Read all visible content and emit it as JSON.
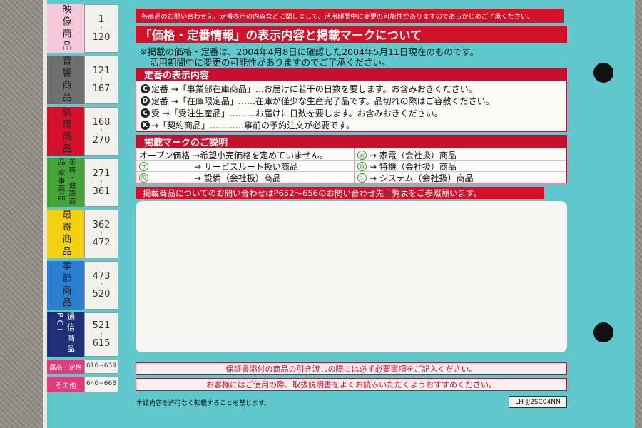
{
  "index": [
    {
      "label": "映像商品",
      "range_from": "1",
      "range_to": "120",
      "color": "#f5c7da"
    },
    {
      "label": "音響商品",
      "range_from": "121",
      "range_to": "167",
      "color": "#6f6f6f"
    },
    {
      "label": "調理商品",
      "range_from": "168",
      "range_to": "270",
      "color": "#d3122a"
    },
    {
      "label": "美容・健康商品 家事商品",
      "range_from": "271",
      "range_to": "361",
      "color": "#45a536"
    },
    {
      "label": "最寄商品",
      "range_from": "362",
      "range_to": "472",
      "color": "#f2d20e"
    },
    {
      "label": "季節商品",
      "range_from": "473",
      "range_to": "520",
      "color": "#2a7fd0"
    },
    {
      "label": "通信商品 PCI",
      "range_from": "521",
      "range_to": "615",
      "color": "#1e2f78"
    },
    {
      "label": "属品・定格",
      "range_text": "616~639",
      "color": "#e33a7a"
    },
    {
      "label": "その他",
      "range_text": "640~668",
      "color": "#e33a7a"
    }
  ],
  "notice": "各商品のお問い合わせ先、定番表示の内容などに関しまして、活用期間中に変更の可能性がありますのであらかじめご了承ください。",
  "title": "「価格・定番情報」の表示内容と掲載マークについて",
  "note_line1": "※掲載の価格・定番は、2004年4月8日に確認した2004年5月11日現在のものです。",
  "note_line2": "活用期間中に変更の可能性がありますのでご了承ください。",
  "teiban": {
    "header": "定番の表示内容",
    "rows": [
      {
        "badge": "C",
        "text": "定番 →「事業部在庫商品」…お届けに若干の日数を要します。お含みおきください。"
      },
      {
        "badge": "D",
        "text": "定番 →「在庫限定品」……在庫が僅少な生産完了品です。品切れの際はご容赦ください。"
      },
      {
        "badge": "C",
        "text": "受 →「受注生産品」………お届けに日数を要します。お含みおきください。"
      },
      {
        "badge": "K",
        "text": "→「契約商品」…………事前の予約注文が必要です。"
      }
    ]
  },
  "marks": {
    "header": "掲載マークのご説明",
    "left": [
      {
        "mark": "",
        "text": "オープン価格 →希望小売価格を定めていません。"
      },
      {
        "mark": "サ",
        "text": "→ サービスルート扱い商品"
      },
      {
        "mark": "設",
        "text": "→ 設備（会社扱）商品"
      }
    ],
    "right": [
      {
        "mark": "家",
        "text": "→ 家電（会社扱）商品"
      },
      {
        "mark": "特",
        "text": "→ 特機（会社扱）商品"
      },
      {
        "mark": "シ",
        "text": "→ システム（会社扱）商品"
      }
    ]
  },
  "contact": "掲載商品についてのお問い合わせはP652～656のお問い合わせ先一覧表をご参照願います。",
  "footer1": "保証書添付の商品の引き渡しの際には必ず必要事項をご記入ください。",
  "footer2": "お客様にはご使用の際、取扱説明書をよくお読みいただくようおすすめください。",
  "copyright": "本誌内容を許可なく転載することを禁じます。",
  "code": "LH-JJ2SC04NN"
}
